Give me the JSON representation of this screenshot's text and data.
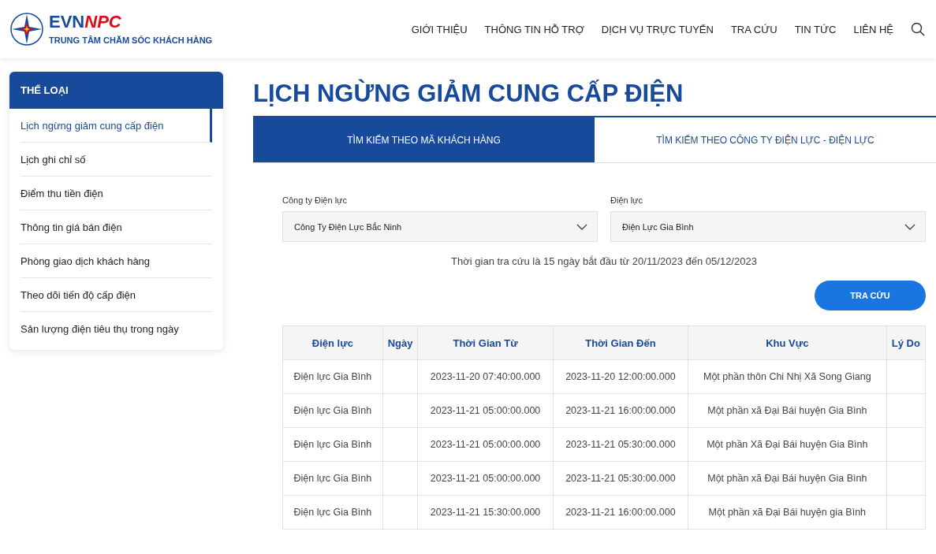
{
  "header": {
    "logo_left": "EVN",
    "logo_right": "NPC",
    "tagline": "TRUNG TÂM CHĂM SÓC KHÁCH HÀNG",
    "nav": [
      {
        "label": "GIỚI THIỆU"
      },
      {
        "label": "THÔNG TIN HỖ TRỢ"
      },
      {
        "label": "DỊCH VỤ TRỰC TUYẾN"
      },
      {
        "label": "TRA CỨU"
      },
      {
        "label": "TIN TỨC"
      },
      {
        "label": "LIÊN HỆ"
      }
    ]
  },
  "sidebar": {
    "title": "THỂ LOẠI",
    "items": [
      {
        "label": "Lịch ngừng giảm cung cấp điện",
        "selected": true
      },
      {
        "label": "Lịch ghi chỉ số",
        "selected": false
      },
      {
        "label": "Điểm thu tiền điện",
        "selected": false
      },
      {
        "label": "Thông tin giá bán điện",
        "selected": false
      },
      {
        "label": "Phòng giao dịch khách hàng",
        "selected": false
      },
      {
        "label": "Theo dõi tiến độ cấp điện",
        "selected": false
      },
      {
        "label": "Sản lượng điện tiêu thụ trong ngày",
        "selected": false
      }
    ]
  },
  "page_title": "LỊCH NGỪNG GIẢM CUNG CẤP ĐIỆN",
  "tabs": [
    {
      "label": "TÌM KIẾM THEO MÃ KHÁCH HÀNG",
      "selected": true
    },
    {
      "label": "TÌM KIẾM THEO CÔNG TY ĐIỆN LỰC - ĐIỆN LỰC",
      "selected": false
    }
  ],
  "form": {
    "fields": [
      {
        "label": "Công ty Điện lực",
        "value": "Công Ty Điện Lực Bắc Ninh"
      },
      {
        "label": "Điện lực",
        "value": "Điện Lực Gia Bình"
      }
    ],
    "note": "Thời gian tra cứu là 15 ngày bắt đầu từ 20/11/2023 đến 05/12/2023",
    "button": "TRA CỨU"
  },
  "table": {
    "columns": [
      "Điện lực",
      "Ngày",
      "Thời Gian Từ",
      "Thời Gian Đến",
      "Khu Vực",
      "Lý Do"
    ],
    "rows": [
      [
        "Điện lực Gia Bình",
        "",
        "2023-11-20 07:40:00.000",
        "2023-11-20 12:00:00.000",
        "Một phần thôn Chi Nhị Xã Song Giang",
        ""
      ],
      [
        "Điện lực Gia Bình",
        "",
        "2023-11-21 05:00:00.000",
        "2023-11-21 16:00:00.000",
        "Một phần xã Đại Bái huyện Gia Bình",
        ""
      ],
      [
        "Điện lực Gia Bình",
        "",
        "2023-11-21 05:00:00.000",
        "2023-11-21 05:30:00.000",
        "Một phần Xã Đại Bái huyện Gia Bình",
        ""
      ],
      [
        "Điện lực Gia Bình",
        "",
        "2023-11-21 05:00:00.000",
        "2023-11-21 05:30:00.000",
        "Một phần xã Đại Bái huyện Gia Bình",
        ""
      ],
      [
        "Điện lực Gia Bình",
        "",
        "2023-11-21 15:30:00.000",
        "2023-11-21 16:00:00.000",
        "Một phần xã Đại Bái huyện gia Bình",
        ""
      ]
    ]
  }
}
